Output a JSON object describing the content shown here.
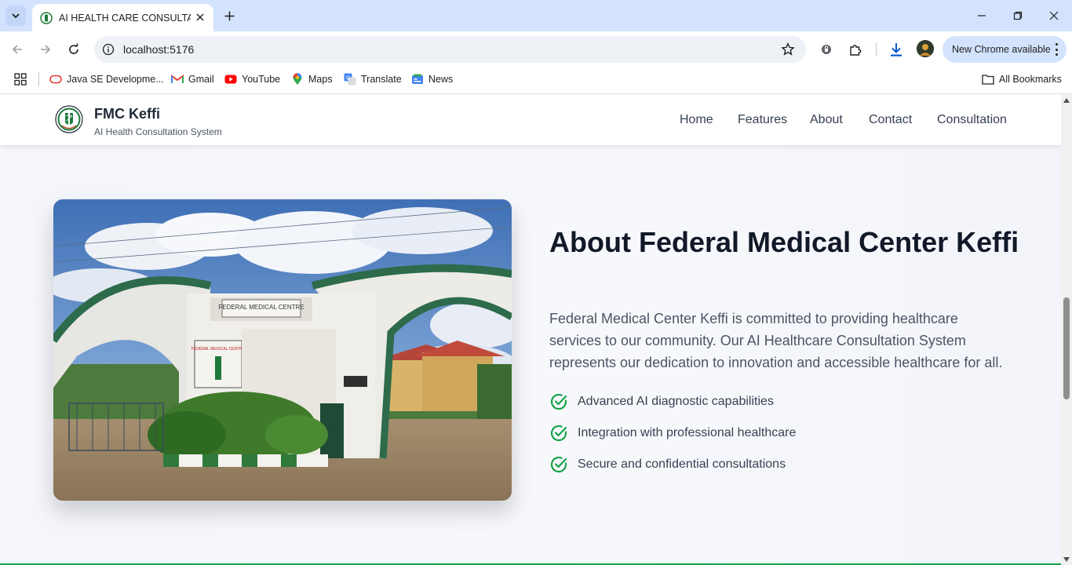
{
  "browser": {
    "tab": {
      "title": "AI HEALTH CARE CONSULTATION"
    },
    "address_bar": {
      "url": "localhost:5176"
    },
    "update_button": {
      "label": "New Chrome available"
    },
    "bookmarks": [
      {
        "label": "Java SE Developme...",
        "icon": "java-icon"
      },
      {
        "label": "Gmail",
        "icon": "gmail-icon"
      },
      {
        "label": "YouTube",
        "icon": "youtube-icon"
      },
      {
        "label": "Maps",
        "icon": "maps-icon"
      },
      {
        "label": "Translate",
        "icon": "translate-icon"
      },
      {
        "label": "News",
        "icon": "news-icon"
      }
    ],
    "all_bookmarks": {
      "label": "All Bookmarks"
    }
  },
  "site": {
    "brand": {
      "name": "FMC Keffi",
      "subtitle": "AI Health Consultation System"
    },
    "nav": [
      {
        "label": "Home"
      },
      {
        "label": "Features"
      },
      {
        "label": "About"
      },
      {
        "label": "Contact"
      },
      {
        "label": "Consultation"
      }
    ]
  },
  "about": {
    "title": "About Federal Medical Center Keffi",
    "description": "Federal Medical Center Keffi is committed to providing healthcare services to our community. Our AI Healthcare Consultation System represents our dedication to innovation and accessible healthcare for all.",
    "features": [
      {
        "label": "Advanced AI diagnostic capabilities"
      },
      {
        "label": "Integration with professional healthcare"
      },
      {
        "label": "Secure and confidential consultations"
      }
    ],
    "photo": {
      "gate_sign_top": "FEDERAL MEDICAL CENTRE",
      "gate_sign_front": "FEDERAL MEDICAL CENTRE"
    }
  },
  "colors": {
    "accent_green": "#16a34a",
    "chrome_blue": "#d3e3fd",
    "title_text": "#111827"
  }
}
